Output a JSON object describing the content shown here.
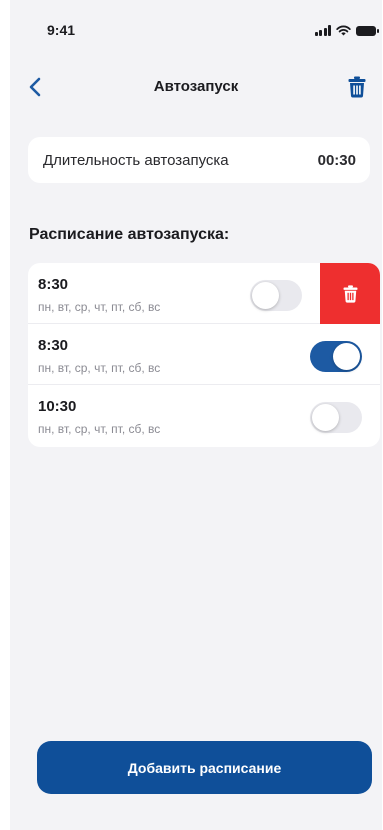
{
  "status_bar": {
    "time": "9:41"
  },
  "nav": {
    "title": "Автозапуск",
    "back_icon": "chevron-left-icon",
    "trash_icon": "trash-icon"
  },
  "duration": {
    "label": "Длительность автозапуска",
    "value": "00:30"
  },
  "schedule": {
    "title": "Расписание автозапуска:",
    "items": [
      {
        "time": "8:30",
        "days": "пн, вт, ср, чт, пт, сб, вс",
        "enabled": false,
        "swiped": true
      },
      {
        "time": "8:30",
        "days": "пн, вт, ср, чт, пт, сб, вс",
        "enabled": true,
        "swiped": false
      },
      {
        "time": "10:30",
        "days": "пн, вт, ср, чт, пт, сб, вс",
        "enabled": false,
        "swiped": false
      }
    ]
  },
  "add_button": {
    "label": "Добавить расписание"
  },
  "colors": {
    "accent": "#0f4f99",
    "toggle_on": "#1d5aa3",
    "delete": "#ee2f2f",
    "background": "#f3f3f6"
  }
}
